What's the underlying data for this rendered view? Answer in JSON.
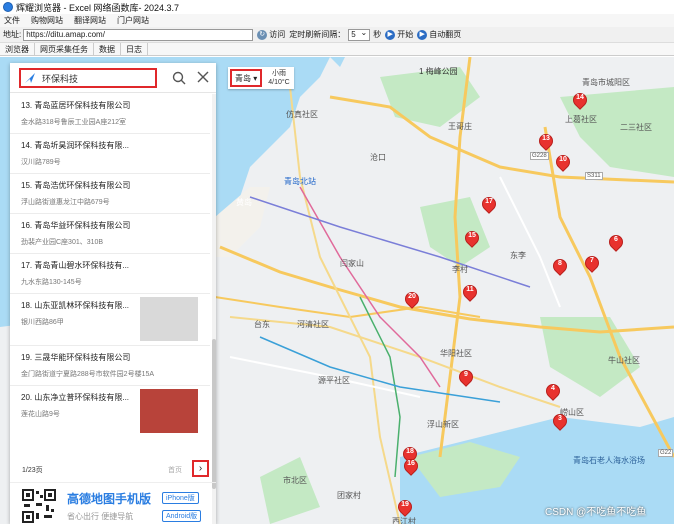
{
  "window": {
    "title": "辉耀浏览器 - Excel 网络函数库- 2024.3.7"
  },
  "menu": [
    "文件",
    "购物网站",
    "翻译网站",
    "门户网站"
  ],
  "addressbar": {
    "label": "地址:",
    "url": "https://ditu.amap.com/",
    "visit": "访问",
    "timer_label": "定时刷新间隔：",
    "interval": "5",
    "seconds": "秒",
    "start": "开始",
    "auto_page": "自动翻页"
  },
  "tabs": [
    "浏览器",
    "网页采集任务",
    "数据",
    "日志"
  ],
  "map": {
    "city": "青岛 ▾",
    "weather_line1": "小雨",
    "weather_line2": "4/10°C",
    "labels": [
      "1 梅峰公园",
      "青岛市城阳区",
      "上葛社区",
      "王哥庄",
      "二三社区",
      "仿真社区",
      "沧口",
      "青岛北站",
      "黄岛",
      "东李",
      "李村",
      "闫家山",
      "台东",
      "河清社区",
      "华阳社区",
      "浮山新区",
      "崂山区",
      "牛山社区",
      "青岛石老人海水浴场",
      "市北区",
      "团家村",
      "源平社区",
      "西江村",
      "G228",
      "S311",
      "G22"
    ],
    "pins": [
      "14",
      "13",
      "10",
      "17",
      "15",
      "6",
      "8",
      "7",
      "11",
      "20",
      "9",
      "4",
      "3",
      "18",
      "16",
      "19"
    ]
  },
  "panel": {
    "query": "环保科技",
    "results": [
      {
        "name": "13. 青岛蓝居环保科技有限公司",
        "addr": "金水路318号鲁辰工业园A座212室",
        "has_thumb": false
      },
      {
        "name": "14. 青岛圻昊润环保科技有限...",
        "addr": "汉川路789号",
        "has_thumb": false
      },
      {
        "name": "15. 青岛浩优环保科技有限公司",
        "addr": "浮山路街道惠龙江中路679号",
        "has_thumb": false
      },
      {
        "name": "16. 青岛华益环保科技有限公司",
        "addr": "劲裴产业园C座301、310B",
        "has_thumb": false
      },
      {
        "name": "17. 青岛青山碧水环保科技有...",
        "addr": "九水东路130-145号",
        "has_thumb": false
      },
      {
        "name": "18. 山东亚凯林环保科技有限...",
        "addr": "银川西路86甲",
        "has_thumb": true
      },
      {
        "name": "19. 三晟华能环保科技有限公司",
        "addr": "金门路街道宁夏路288号市软件园2号楼15A",
        "has_thumb": false
      },
      {
        "name": "20. 山东净立普环保科技有限...",
        "addr": "莲花山路9号",
        "has_thumb": true
      }
    ],
    "page_count": "1/23页",
    "prev": "首页",
    "next": "›",
    "banner_title": "高德地图手机版",
    "banner_sub": "省心出行 便捷导航",
    "tag_iphone": "iPhone版",
    "tag_android": "Android版"
  },
  "watermark": "CSDN @不吃鱼不吃鱼",
  "colors": {
    "highlight": "#e0282b",
    "pin": "#e8322e",
    "water": "#aadbf5",
    "green": "#c4e9c4",
    "accent": "#2a7de1"
  }
}
